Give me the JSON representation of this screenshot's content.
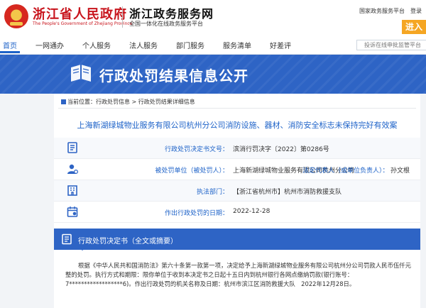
{
  "header": {
    "gov_name": "浙江省人民政府",
    "gov_name_en": "The People's Government of Zhejiang Province",
    "service_name": "浙江政务服务网",
    "service_sub": "全国一体化在线政务服务平台",
    "links": [
      "国家政务服务平台",
      "登录"
    ],
    "enter_label": "进入"
  },
  "nav": {
    "items": [
      "首页",
      "一网通办",
      "个人服务",
      "法人服务",
      "部门服务",
      "服务清单",
      "好差评"
    ],
    "active_index": 0,
    "search_placeholder": "投诉在线申批监管平台"
  },
  "banner": {
    "title": "行政处罚结果信息公开"
  },
  "breadcrumb": {
    "prefix": "当前位置：",
    "items": [
      "行政处罚信息",
      "行政处罚结果详细信息"
    ],
    "separator": " > "
  },
  "case": {
    "title": "上海新湖绿城物业服务有限公司杭州分公司消防设施、器材、消防安全标志未保持完好有效案",
    "rows": [
      {
        "icon": "document-icon",
        "label": "行政处罚决定书文号：",
        "value": "滨消行罚决字〔2022〕第0286号"
      },
      {
        "icon": "person-icon",
        "label": "被处罚单位（被处罚人）：",
        "value": "上海新湖绿城物业服务有限公司杭州分公司",
        "label2": "法定代表人（或单位负责人）：",
        "value2": "孙文根"
      },
      {
        "icon": "building-icon",
        "label": "执法部门：",
        "value": "【浙江省杭州市】杭州市消防救援支队"
      },
      {
        "icon": "calendar-icon",
        "label": "作出行政处罚的日期：",
        "value": "2022-12-28"
      }
    ]
  },
  "decision": {
    "section_title": "行政处罚决定书（全文或摘要）",
    "text": "根据《中华人民共和国消防法》第六十条第一款第一项，决定给予上海新湖绿城物业服务有限公司杭州分公司罚款人民币伍仟元整的处罚。执行方式和期限：限你单位于收到本决定书之日起十五日内到杭州银行各网点缴纳罚款(银行账号：7******************6)。作出行政处罚的机关名称及日期：杭州市滨江区消防救援大队　2022年12月28日。"
  },
  "colors": {
    "primary": "#2e64c5",
    "gov_red": "#c8141c",
    "accent_orange": "#f5a623"
  }
}
